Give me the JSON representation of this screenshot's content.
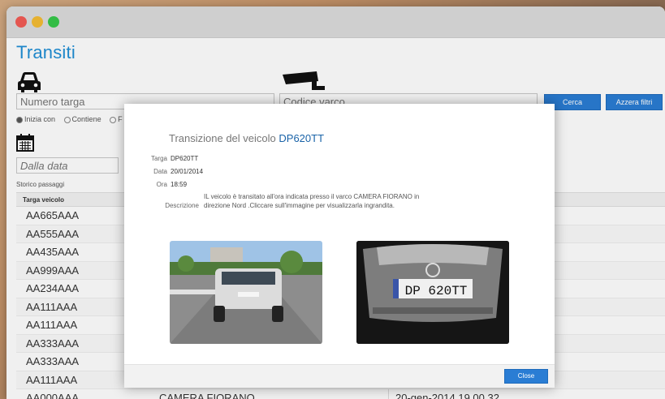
{
  "window": {
    "title": "Transiti"
  },
  "filters": {
    "plate_placeholder": "Numero targa",
    "gate_placeholder": "Codice varco",
    "search_label": "Cerca",
    "reset_label": "Azzera filtri",
    "match_modes": [
      "Inizia con",
      "Contiene",
      "F"
    ],
    "date_from_placeholder": "Dalla data"
  },
  "history": {
    "label": "Storico passaggi",
    "column_plate": "Targa veicolo",
    "rows": [
      {
        "plate": "AA665AAA"
      },
      {
        "plate": "AA555AAA"
      },
      {
        "plate": "AA435AAA"
      },
      {
        "plate": "AA999AAA"
      },
      {
        "plate": "AA234AAA"
      },
      {
        "plate": "AA111AAA"
      },
      {
        "plate": "AA111AAA"
      },
      {
        "plate": "AA333AAA"
      },
      {
        "plate": "AA333AAA"
      },
      {
        "plate": "AA111AAA"
      },
      {
        "plate": "AA000AAA",
        "gate": "CAMERA FIORANO",
        "date": "20-gen-2014 19.00.32"
      }
    ]
  },
  "modal": {
    "title_prefix": "Transizione del veicolo",
    "title_plate": "DP620TT",
    "targa_key": "Targa",
    "targa_value": "DP620TT",
    "data_key": "Data",
    "data_value": "20/01/2014",
    "ora_key": "Ora",
    "ora_value": "18:59",
    "desc_key": "Descrizione",
    "desc_value": "IL veicolo è transitato all'ora indicata presso il varco CAMERA FIORANO in direzione Nord .Cliccare sull'immagine per visualizzarla ingrandita.",
    "plate_image_text": "DP 620TT",
    "close_label": "Close"
  },
  "colors": {
    "accent": "#2a7dd4",
    "title": "#1f8fd6"
  }
}
